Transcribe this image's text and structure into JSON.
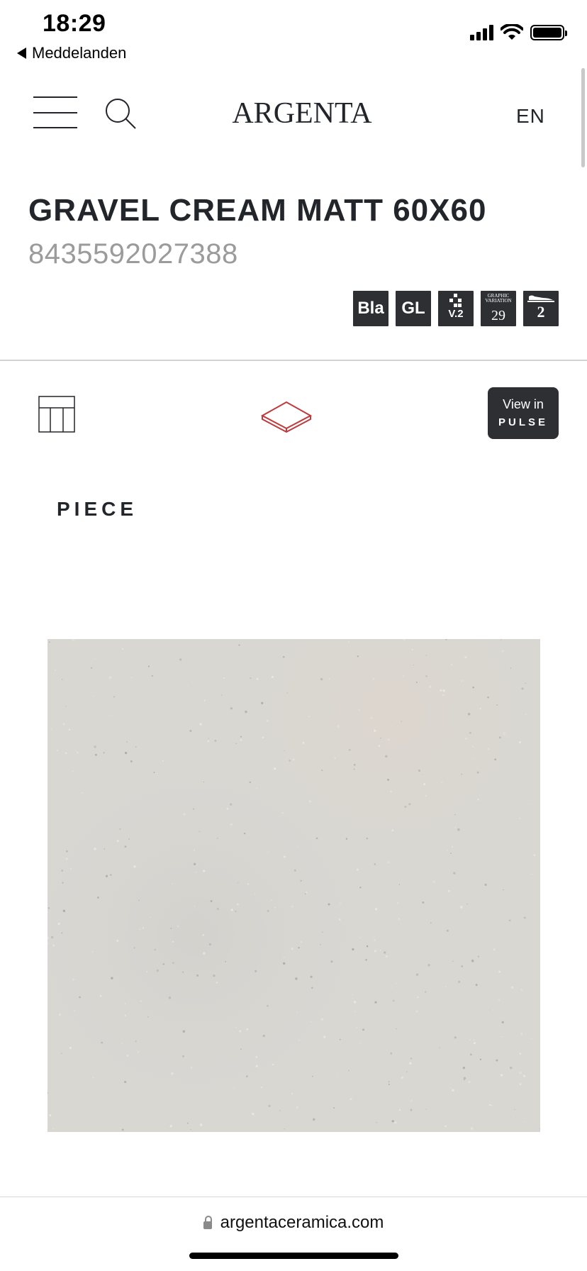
{
  "status_bar": {
    "time": "18:29",
    "back_label": "Meddelanden"
  },
  "header": {
    "logo": "ARGENTA",
    "language": "EN"
  },
  "product": {
    "title": "GRAVEL CREAM MATT 60X60",
    "code": "8435592027388"
  },
  "badges": [
    {
      "label": "Bla",
      "icon": "bla-badge"
    },
    {
      "label": "GL",
      "icon": "gl-badge"
    },
    {
      "label": "V.2",
      "icon": "variation-v2-icon"
    },
    {
      "label_top": "GRAPHIC VARIATION",
      "label": "29",
      "icon": "graphic-variation-badge"
    },
    {
      "label": "2",
      "icon": "slip-resistance-icon"
    }
  ],
  "view_controls": {
    "pulse_line1": "View in",
    "pulse_line2": "PULSE",
    "active_color": "#c0393b"
  },
  "section": {
    "label": "PIECE"
  },
  "tile": {
    "color": "#d9d7d2"
  },
  "browser": {
    "url": "argentaceramica.com"
  }
}
